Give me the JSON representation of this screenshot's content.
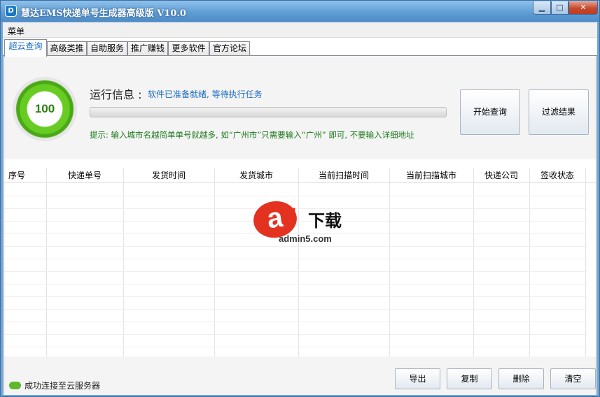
{
  "window": {
    "title": "慧达EMS快递单号生成器高级版 V10.0",
    "icon_text": "D",
    "min_symbol": "▁",
    "max_symbol": "□",
    "close_symbol": "✕"
  },
  "menubar": {
    "menu_label": "菜单"
  },
  "tabs": [
    {
      "label": "超云查询",
      "active": true
    },
    {
      "label": "高级类推"
    },
    {
      "label": "自助服务"
    },
    {
      "label": "推广赚钱"
    },
    {
      "label": "更多软件"
    },
    {
      "label": "官方论坛"
    }
  ],
  "info": {
    "gauge_value": "100",
    "run_label": "运行信息 :",
    "run_status": "软件已准备就绪, 等待执行任务",
    "progress": 0,
    "tip": "提示: 输入城市名越简单单号就越多, 如“广州市”只需要输入“广州” 即可, 不要输入详细地址",
    "start_button": "开始查询",
    "filter_button": "过滤结果"
  },
  "grid": {
    "columns": [
      "序号",
      "快递单号",
      "发货时间",
      "发货城市",
      "当前扫描时间",
      "当前扫描城市",
      "快递公司",
      "签收状态"
    ]
  },
  "watermark": {
    "mark": "a",
    "digit": "5",
    "text": "下载",
    "url": "admin5.com"
  },
  "footer": {
    "status": "成功连接至云服务器",
    "export": "导出",
    "copy": "复制",
    "delete": "删除",
    "clear": "清空"
  },
  "colors": {
    "title_blue": "#5d9bd3",
    "gauge_green": "#66cc22",
    "status_blue": "#1a6bc2",
    "tip_green": "#1a7a1a",
    "watermark_red": "#e3321f"
  }
}
